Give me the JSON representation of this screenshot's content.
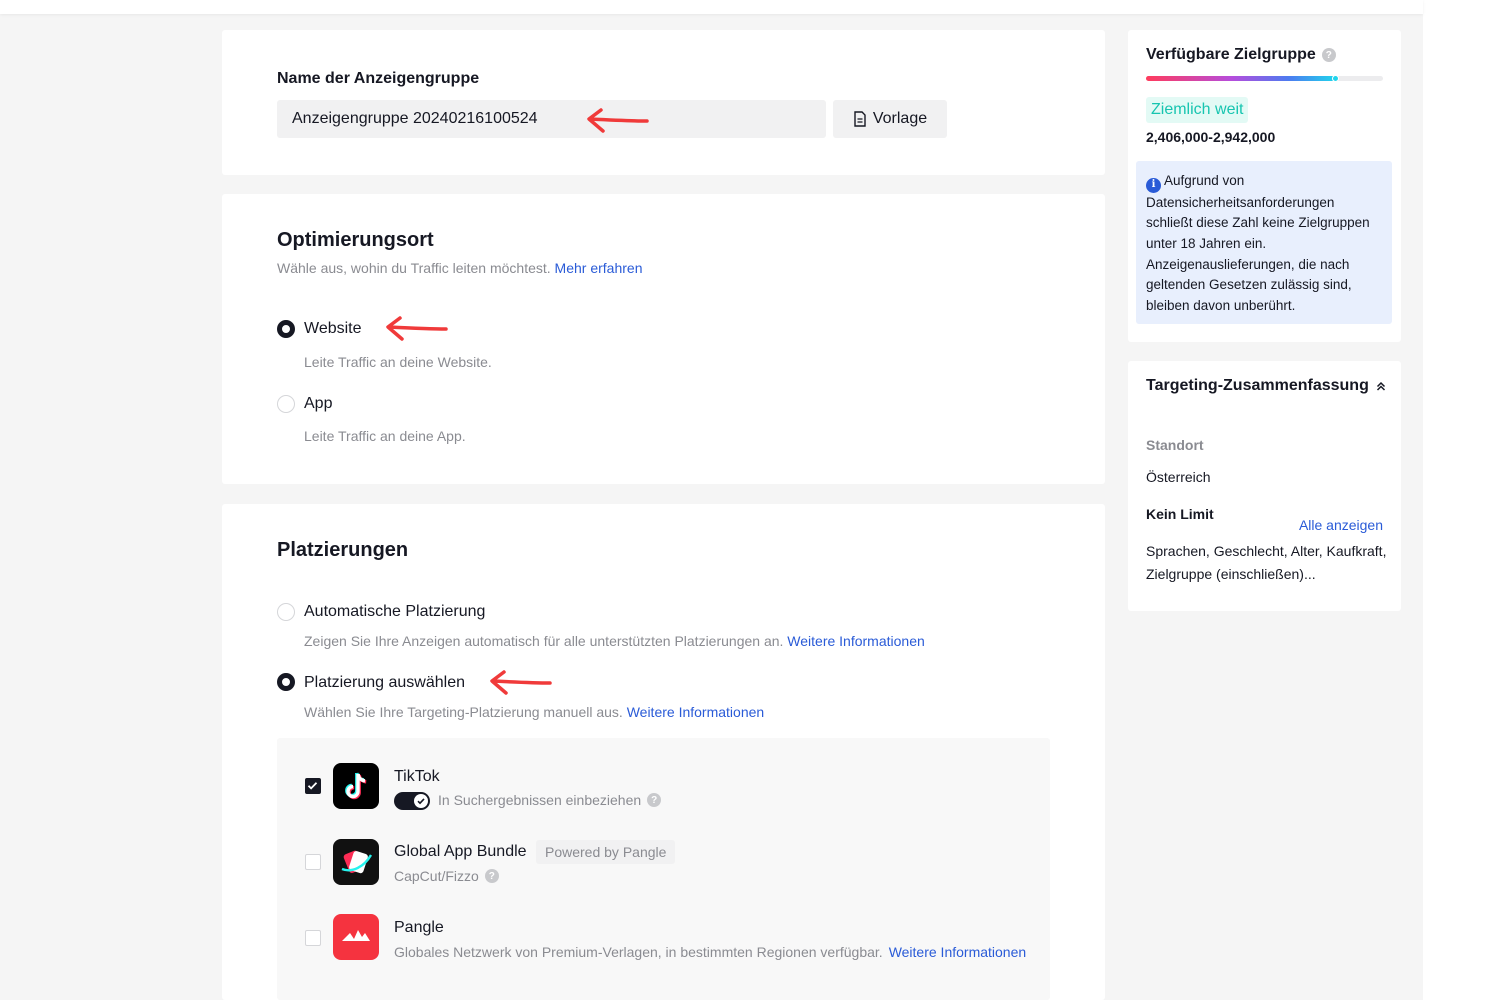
{
  "name_section": {
    "label": "Name der Anzeigengruppe",
    "input_value": "Anzeigengruppe 20240216100524",
    "template_button": "Vorlage"
  },
  "optimization": {
    "title": "Optimierungsort",
    "subtitle": "Wähle aus, wohin du Traffic leiten möchtest.",
    "learn_more": "Mehr erfahren",
    "options": [
      {
        "label": "Website",
        "description": "Leite Traffic an deine Website.",
        "selected": true
      },
      {
        "label": "App",
        "description": "Leite Traffic an deine App.",
        "selected": false
      }
    ]
  },
  "placements": {
    "title": "Platzierungen",
    "options": [
      {
        "label": "Automatische Platzierung",
        "description": "Zeigen Sie Ihre Anzeigen automatisch für alle unterstützten Platzierungen an.",
        "link": "Weitere Informationen",
        "selected": false
      },
      {
        "label": "Platzierung auswählen",
        "description": "Wählen Sie Ihre Targeting-Platzierung manuell aus.",
        "link": "Weitere Informationen",
        "selected": true
      }
    ],
    "platforms": [
      {
        "name": "TikTok",
        "toggle_label": "In Suchergebnissen einbeziehen",
        "checked": true,
        "icon": "tiktok-logo-icon"
      },
      {
        "name": "Global App Bundle",
        "badge": "Powered by Pangle",
        "sub": "CapCut/Fizzo",
        "checked": false,
        "icon": "global-app-bundle-icon"
      },
      {
        "name": "Pangle",
        "sub": "Globales Netzwerk von Premium-Verlagen, in bestimmten Regionen verfügbar.",
        "link": "Weitere Informationen",
        "checked": false,
        "icon": "pangle-logo-icon"
      }
    ]
  },
  "audience": {
    "title": "Verfügbare Zielgruppe",
    "level_fraction": 0.8,
    "badge": "Ziemlich weit",
    "range": "2,406,000-2,942,000",
    "info": "Aufgrund von Datensicherheitsanforderungen schließt diese Zahl keine Zielgruppen unter 18 Jahren ein. Anzeigenauslieferungen, die nach geltenden Gesetzen zulässig sind, bleiben davon unberührt."
  },
  "targeting": {
    "title": "Targeting-Zusammenfassung",
    "location_label": "Standort",
    "location_value": "Österreich",
    "limit_label": "Kein Limit",
    "show_all": "Alle anzeigen",
    "limit_desc": "Sprachen, Geschlecht, Alter, Kaufkraft, Zielgruppe (einschließen)..."
  },
  "colors": {
    "accent_link": "#2a5bd7",
    "annotation_arrow": "#f03a3a",
    "badge_green": "#17c5b0"
  }
}
